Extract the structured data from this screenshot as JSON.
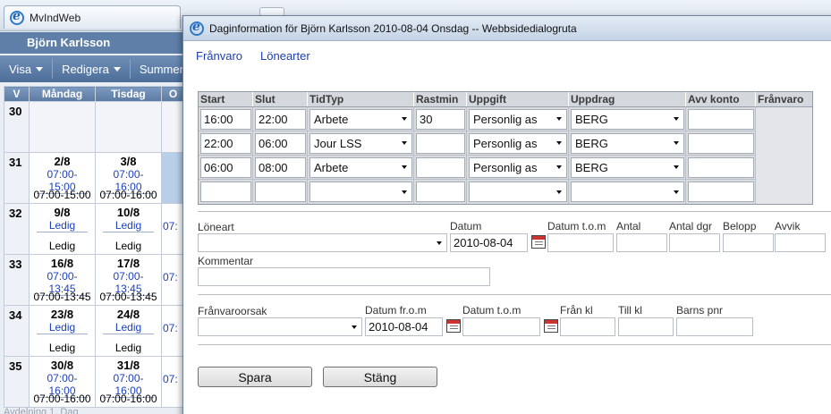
{
  "background_window": {
    "tab_title": "MvIndWeb",
    "user_name": "Björn Karlsson",
    "menu": [
      "Visa",
      "Redigera",
      "Summer"
    ],
    "columns": [
      "V",
      "Måndag",
      "Tisdag",
      "O"
    ],
    "weeks": [
      {
        "week": "30",
        "mon": null,
        "tue": null,
        "partial": ""
      },
      {
        "week": "31",
        "mon": {
          "date": "2/8",
          "blue": "07:00-15:00",
          "bottom": "07:00-15:00"
        },
        "tue": {
          "date": "3/8",
          "blue": "07:00-16:00",
          "bottom": "07:00-16:00"
        },
        "partial": "07:"
      },
      {
        "week": "32",
        "mon": {
          "date": "9/8",
          "blue": "Ledig",
          "bottom": "Ledig"
        },
        "tue": {
          "date": "10/8",
          "blue": "Ledig",
          "bottom": "Ledig"
        },
        "partial": "07:"
      },
      {
        "week": "33",
        "mon": {
          "date": "16/8",
          "blue": "07:00-13:45",
          "bottom": "07:00-13:45"
        },
        "tue": {
          "date": "17/8",
          "blue": "07:00-13:45",
          "bottom": "07:00-13:45"
        },
        "partial": "07:"
      },
      {
        "week": "34",
        "mon": {
          "date": "23/8",
          "blue": "Ledig",
          "bottom": "Ledig"
        },
        "tue": {
          "date": "24/8",
          "blue": "Ledig",
          "bottom": "Ledig"
        },
        "partial": "07:"
      },
      {
        "week": "35",
        "mon": {
          "date": "30/8",
          "blue": "07:00-16:00",
          "bottom": "07:00-16:00"
        },
        "tue": {
          "date": "31/8",
          "blue": "07:00-16:00",
          "bottom": "07:00-16:00"
        },
        "partial": "07:"
      }
    ],
    "footer": "Avdelning 1, Dag"
  },
  "dialog": {
    "title": "Daginformation för Björn Karlsson 2010-08-04 Onsdag -- Webbsidedialogruta",
    "links": [
      "Frånvaro",
      "Lönearter"
    ],
    "grid": {
      "headers": [
        "Start",
        "Slut",
        "TidTyp",
        "Rastmin",
        "Uppgift",
        "Uppdrag",
        "Avv konto",
        "Frånvaro"
      ],
      "rows": [
        {
          "start": "16:00",
          "slut": "22:00",
          "tidtyp": "Arbete",
          "rastmin": "30",
          "uppgift": "Personlig as",
          "uppdrag": "BERG",
          "avv_konto": ""
        },
        {
          "start": "22:00",
          "slut": "06:00",
          "tidtyp": "Jour LSS",
          "rastmin": "",
          "uppgift": "Personlig as",
          "uppdrag": "BERG",
          "avv_konto": ""
        },
        {
          "start": "06:00",
          "slut": "08:00",
          "tidtyp": "Arbete",
          "rastmin": "",
          "uppgift": "Personlig as",
          "uppdrag": "BERG",
          "avv_konto": ""
        },
        {
          "start": "",
          "slut": "",
          "tidtyp": "",
          "rastmin": "",
          "uppgift": "",
          "uppdrag": "",
          "avv_konto": ""
        }
      ]
    },
    "loneart_section": {
      "loneart_label": "Löneart",
      "loneart_value": "",
      "datum_label": "Datum",
      "datum_value": "2010-08-04",
      "datum_tom_label": "Datum t.o.m",
      "antal_label": "Antal",
      "antal_dgr_label": "Antal dgr",
      "belopp_label": "Belopp",
      "avvik_label": "Avvik",
      "kommentar_label": "Kommentar"
    },
    "franvaro_section": {
      "orsak_label": "Frånvaroorsak",
      "datum_from_label": "Datum fr.o.m",
      "datum_from_value": "2010-08-04",
      "datum_tom_label": "Datum t.o.m",
      "fran_kl_label": "Från kl",
      "till_kl_label": "Till kl",
      "barns_pnr_label": "Barns pnr"
    },
    "buttons": {
      "save": "Spara",
      "close": "Stäng"
    }
  }
}
